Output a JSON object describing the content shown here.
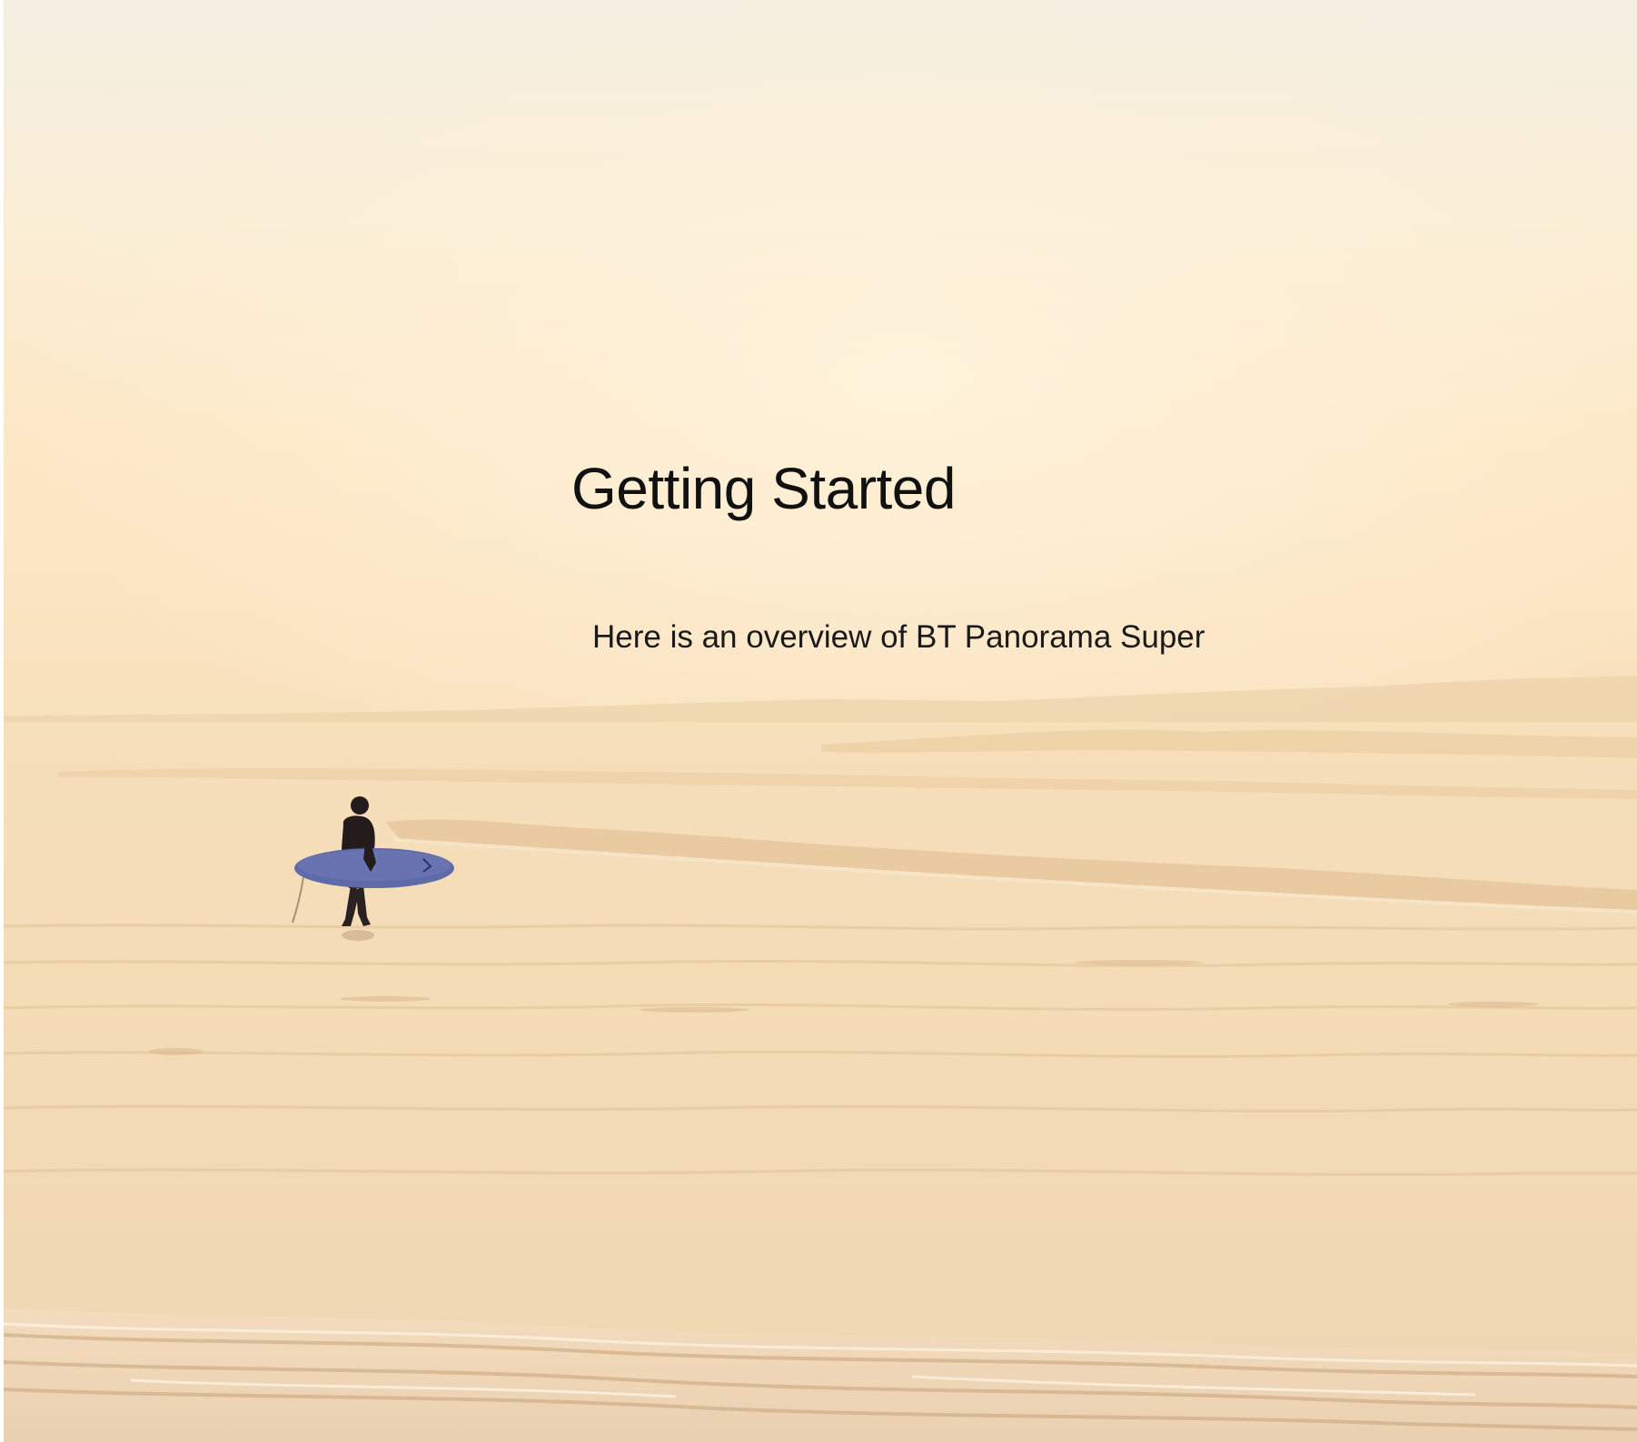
{
  "slide": {
    "title": "Getting Started",
    "subtitle": "Here is an overview of BT Panorama Super"
  },
  "background": {
    "icon": "surfer-beach-photo",
    "sky_color": "#f8ecd4",
    "sea_color": "#f3dcb6",
    "board_color": "#5f6aa8"
  }
}
